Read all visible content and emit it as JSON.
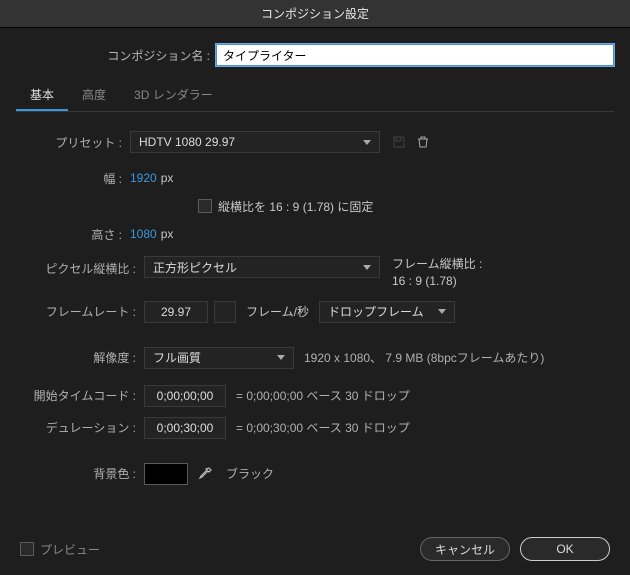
{
  "title": "コンポジション設定",
  "name": {
    "label": "コンポジション名 :",
    "value": "タイプライター"
  },
  "tabs": {
    "basic": "基本",
    "advanced": "高度",
    "renderer": "3D レンダラー"
  },
  "preset": {
    "label": "プリセット :",
    "value": "HDTV 1080 29.97"
  },
  "width": {
    "label": "幅 :",
    "value": "1920",
    "unit": "px"
  },
  "height": {
    "label": "高さ :",
    "value": "1080",
    "unit": "px"
  },
  "aspect_lock": {
    "label": "縦横比を 16 : 9 (1.78) に固定"
  },
  "pixel_aspect": {
    "label": "ピクセル縦横比 :",
    "value": "正方形ピクセル"
  },
  "frame_aspect": {
    "label": "フレーム縦横比 :",
    "value": "16 : 9 (1.78)"
  },
  "frame_rate": {
    "label": "フレームレート :",
    "value": "29.97",
    "unit_label": "フレーム/秒",
    "drop_value": "ドロップフレーム"
  },
  "resolution": {
    "label": "解像度 :",
    "value": "フル画質",
    "info": "1920 x 1080、 7.9 MB (8bpcフレームあたり)"
  },
  "start": {
    "label": "開始タイムコード :",
    "value": "0;00;00;00",
    "info": "= 0;00;00;00 ベース 30 ドロップ"
  },
  "duration": {
    "label": "デュレーション :",
    "value": "0;00;30;00",
    "info": "= 0;00;30;00 ベース 30 ドロップ"
  },
  "bg": {
    "label": "背景色 :",
    "value_name": "ブラック",
    "value_hex": "#000000"
  },
  "footer": {
    "preview": "プレビュー",
    "cancel": "キャンセル",
    "ok": "OK"
  }
}
